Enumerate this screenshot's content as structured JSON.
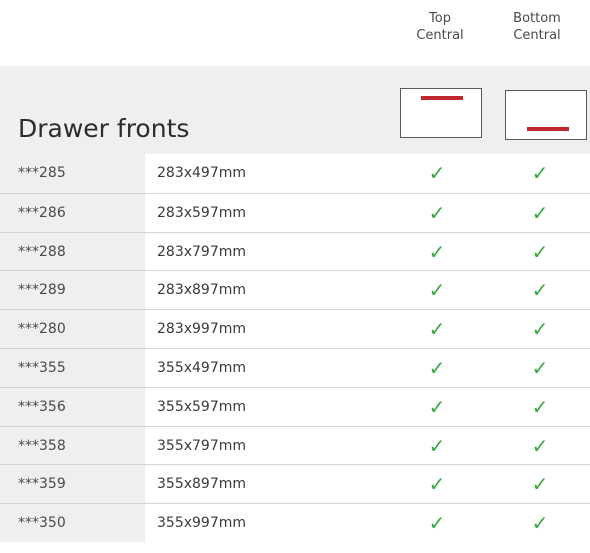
{
  "columns": {
    "top": {
      "line1": "Top",
      "line2": "Central"
    },
    "bottom": {
      "line1": "Bottom",
      "line2": "Central"
    }
  },
  "section_title": "Drawer fronts",
  "check_mark": "✓",
  "colors": {
    "handle": "#c0282e",
    "check": "#3aa843",
    "band": "#efefef"
  },
  "rows": [
    {
      "code": "***285",
      "size": "283x497mm",
      "top": true,
      "bottom": true
    },
    {
      "code": "***286",
      "size": "283x597mm",
      "top": true,
      "bottom": true
    },
    {
      "code": "***288",
      "size": "283x797mm",
      "top": true,
      "bottom": true
    },
    {
      "code": "***289",
      "size": "283x897mm",
      "top": true,
      "bottom": true
    },
    {
      "code": "***280",
      "size": "283x997mm",
      "top": true,
      "bottom": true
    },
    {
      "code": "***355",
      "size": "355x497mm",
      "top": true,
      "bottom": true
    },
    {
      "code": "***356",
      "size": "355x597mm",
      "top": true,
      "bottom": true
    },
    {
      "code": "***358",
      "size": "355x797mm",
      "top": true,
      "bottom": true
    },
    {
      "code": "***359",
      "size": "355x897mm",
      "top": true,
      "bottom": true
    },
    {
      "code": "***350",
      "size": "355x997mm",
      "top": true,
      "bottom": true
    }
  ]
}
